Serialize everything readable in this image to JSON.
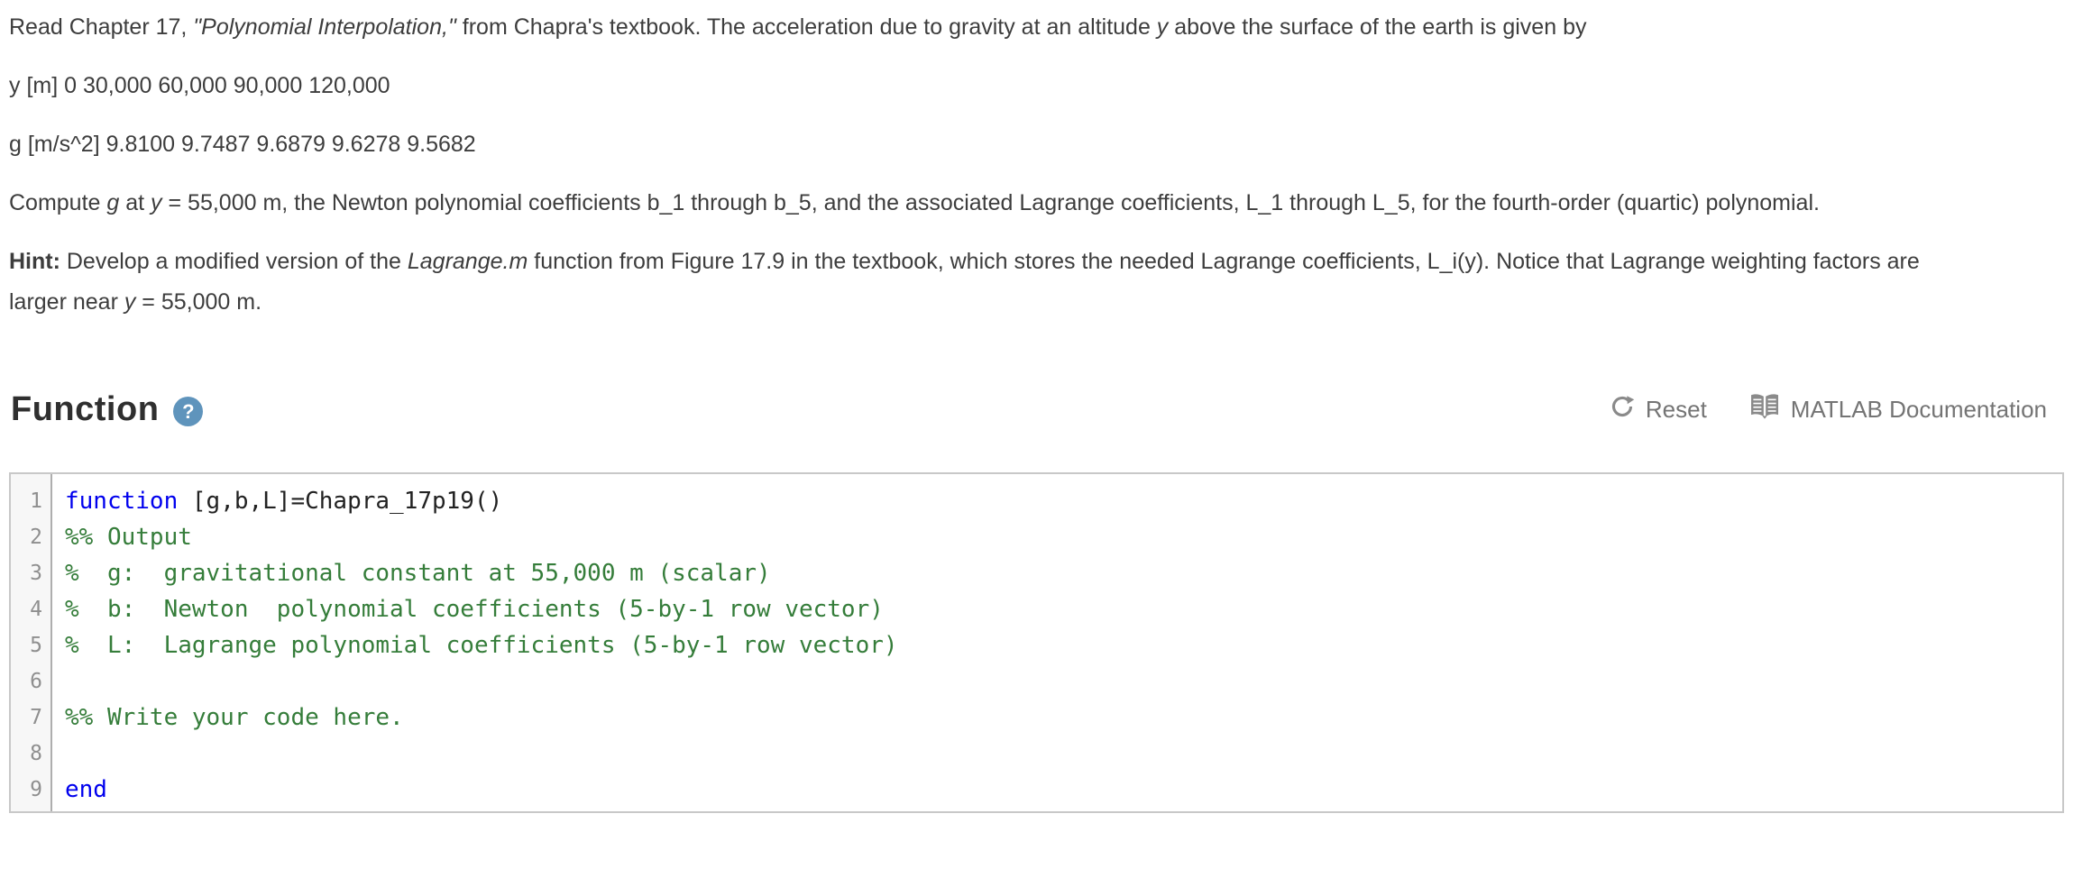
{
  "colors": {
    "keyword_blue": "#0000ee",
    "comment_green": "#357d3a",
    "help_icon_blue": "#5f94bc",
    "action_gray": "#747474",
    "gutter_bg": "#f7f7f7"
  },
  "problem": {
    "intro": {
      "runs": [
        {
          "text": "Read Chapter 17, ",
          "style": "normal"
        },
        {
          "text": "\"Polynomial Interpolation,\"",
          "style": "italic"
        },
        {
          "text": " from Chapra's textbook. The acceleration due to gravity at an altitude ",
          "style": "normal"
        },
        {
          "text": "y",
          "style": "italic"
        },
        {
          "text": " above the surface of the earth is given by",
          "style": "normal"
        }
      ]
    },
    "data_row_y": "y [m] 0 30,000 60,000 90,000 120,000",
    "data_row_g": "g [m/s^2] 9.8100 9.7487 9.6879 9.6278 9.5682",
    "task": {
      "runs": [
        {
          "text": "Compute ",
          "style": "normal"
        },
        {
          "text": "g",
          "style": "italic"
        },
        {
          "text": " at ",
          "style": "normal"
        },
        {
          "text": "y",
          "style": "italic"
        },
        {
          "text": " = 55,000 m, the Newton polynomial coefficients b_1 through b_5, and the associated Lagrange coefficients, L_1 through L_5, for the fourth-order (quartic) polynomial.",
          "style": "normal"
        }
      ]
    },
    "hint": {
      "runs": [
        {
          "text": "Hint:",
          "style": "bold"
        },
        {
          "text": " Develop a modified version of the ",
          "style": "normal"
        },
        {
          "text": "Lagrange.m",
          "style": "italic"
        },
        {
          "text": " function from Figure 17.9 in the textbook, which stores the needed Lagrange coefficients, L_i(y). Notice that Lagrange weighting factors are larger near ",
          "style": "normal"
        },
        {
          "text": "y",
          "style": "italic"
        },
        {
          "text": " = 55,000 m.",
          "style": "normal"
        }
      ]
    }
  },
  "function_section": {
    "title": "Function",
    "help_glyph": "?",
    "actions": [
      {
        "id": "reset",
        "label": "Reset",
        "icon": "reset-icon"
      },
      {
        "id": "matlab-doc",
        "label": "MATLAB Documentation",
        "icon": "book-icon"
      }
    ]
  },
  "editor": {
    "lines": [
      {
        "num": 1,
        "tokens": [
          {
            "text": "function",
            "type": "keyword"
          },
          {
            "text": " [g,b,L]=Chapra_17p19()",
            "type": "plain"
          }
        ]
      },
      {
        "num": 2,
        "tokens": [
          {
            "text": "%% Output",
            "type": "comment"
          }
        ]
      },
      {
        "num": 3,
        "tokens": [
          {
            "text": "%  g:  gravitational constant at 55,000 m (scalar)",
            "type": "comment"
          }
        ]
      },
      {
        "num": 4,
        "tokens": [
          {
            "text": "%  b:  Newton  polynomial coefficients (5-by-1 row vector)",
            "type": "comment"
          }
        ]
      },
      {
        "num": 5,
        "tokens": [
          {
            "text": "%  L:  Lagrange polynomial coefficients (5-by-1 row vector)",
            "type": "comment"
          }
        ]
      },
      {
        "num": 6,
        "tokens": []
      },
      {
        "num": 7,
        "tokens": [
          {
            "text": "%% Write your code here.",
            "type": "comment"
          }
        ]
      },
      {
        "num": 8,
        "tokens": []
      },
      {
        "num": 9,
        "tokens": [
          {
            "text": "end",
            "type": "keyword"
          }
        ]
      }
    ]
  }
}
